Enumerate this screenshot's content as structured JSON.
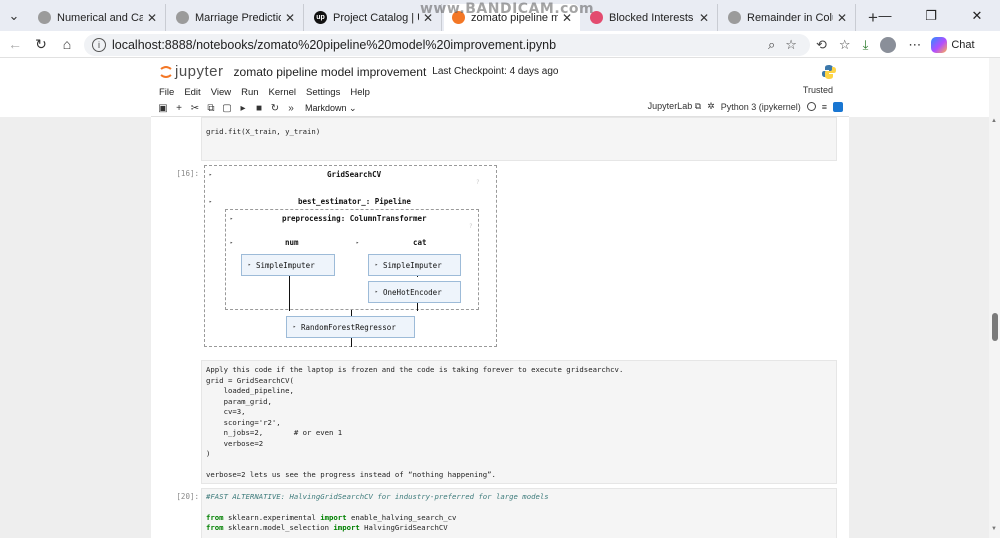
{
  "browser": {
    "tabs": [
      {
        "title": "Numerical and Categoric",
        "favicon_color": "#9b9b9b",
        "favicon_glyph": "globe-icon"
      },
      {
        "title": "Marriage Prediction Rea",
        "favicon_color": "#9b9b9b",
        "favicon_glyph": "globe-icon"
      },
      {
        "title": "Project Catalog | Upwor",
        "favicon_color": "#111111",
        "favicon_glyph": "upwork-icon"
      },
      {
        "title": "zomato pipeline model",
        "favicon_color": "#f37726",
        "favicon_glyph": "jupyter-icon"
      },
      {
        "title": "Blocked Interests | Jeeva",
        "favicon_color": "#e34b6f",
        "favicon_glyph": "app-icon"
      },
      {
        "title": "Remainder in ColumnTra",
        "favicon_color": "#9b9b9b",
        "favicon_glyph": "globe-icon"
      }
    ],
    "watermark": "www.BANDICAM.com",
    "url": "localhost:8888/notebooks/zomato%20pipeline%20model%20improvement.ipynb",
    "chat_label": "Chat"
  },
  "jupyter": {
    "logo_text": "jupyter",
    "notebook_title": "zomato pipeline model improvement",
    "checkpoint": "Last Checkpoint: 4 days ago",
    "menu": [
      "File",
      "Edit",
      "View",
      "Run",
      "Kernel",
      "Settings",
      "Help"
    ],
    "trusted": "Trusted",
    "cell_type": "Markdown",
    "jupyterlab_label": "JupyterLab",
    "kernel_name": "Python 3 (ipykernel)"
  },
  "cells": {
    "cell1_code": "grid.fit(X_train, y_train)",
    "cell2_prompt": "[16]:",
    "diagram": {
      "gridsearch": "GridSearchCV",
      "best_estimator": "best_estimator_: Pipeline",
      "preprocessing": "preprocessing: ColumnTransformer",
      "num": "num",
      "cat": "cat",
      "num_imputer": "SimpleImputer",
      "cat_imputer": "SimpleImputer",
      "encoder": "OneHotEncoder",
      "regressor": "RandomForestRegressor",
      "help_mark": "?"
    },
    "markdown_lines": [
      "Apply this code if the laptop is frozen and the code is taking forever to execute gridsearchcv.",
      "grid = GridSearchCV(",
      "    loaded_pipeline,",
      "    param_grid,",
      "    cv=3,",
      "    scoring='r2',",
      "    n_jobs=2,       # or even 1",
      "    verbose=2",
      ")",
      "",
      "verbose=2 lets us see the progress instead of “nothing happening”."
    ],
    "cell3_prompt": "[20]:",
    "cell3_comment": "#FAST ALTERNATIVE: HalvingGridSearchCV for industry-preferred for large models",
    "cell3_line2": {
      "kw1": "from",
      "mod": " sklearn.experimental ",
      "kw2": "import",
      "name": " enable_halving_search_cv"
    },
    "cell3_line3": {
      "kw1": "from",
      "mod": " sklearn.model_selection ",
      "kw2": "import",
      "name": " HalvingGridSearchCV"
    }
  }
}
